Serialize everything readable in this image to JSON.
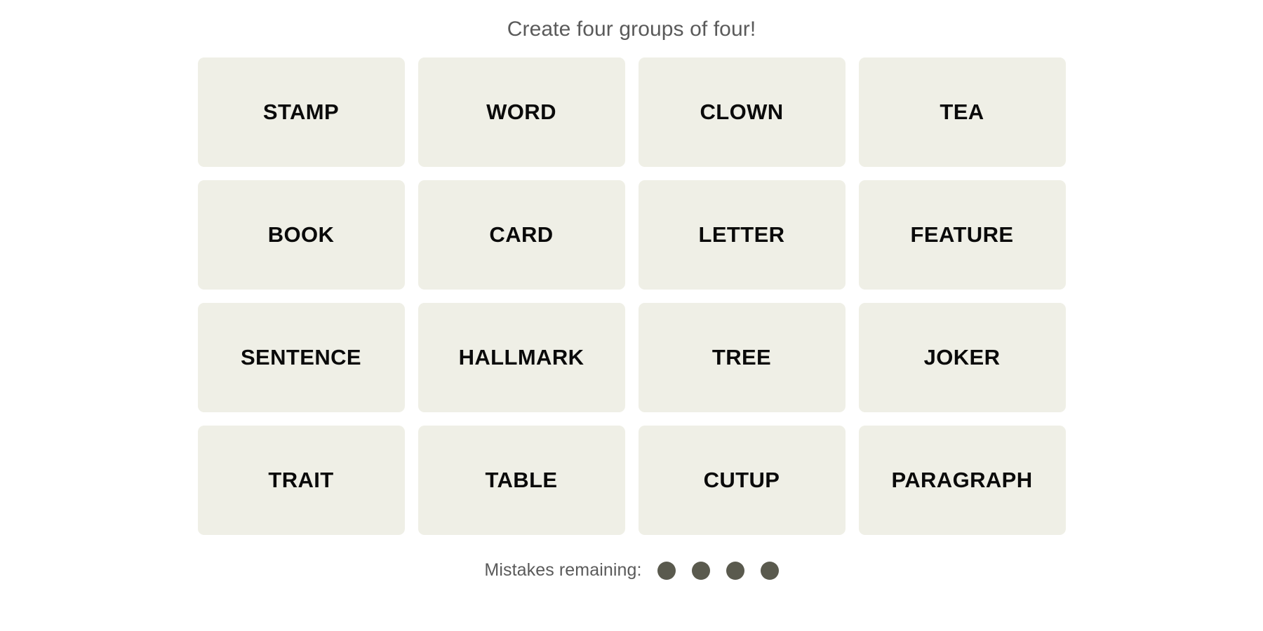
{
  "header": {
    "instruction": "Create four groups of four!"
  },
  "board": {
    "rows": 4,
    "columns": 4,
    "tiles": [
      {
        "label": "STAMP"
      },
      {
        "label": "WORD"
      },
      {
        "label": "CLOWN"
      },
      {
        "label": "TEA"
      },
      {
        "label": "BOOK"
      },
      {
        "label": "CARD"
      },
      {
        "label": "LETTER"
      },
      {
        "label": "FEATURE"
      },
      {
        "label": "SENTENCE"
      },
      {
        "label": "HALLMARK"
      },
      {
        "label": "TREE"
      },
      {
        "label": "JOKER"
      },
      {
        "label": "TRAIT"
      },
      {
        "label": "TABLE"
      },
      {
        "label": "CUTUP"
      },
      {
        "label": "PARAGRAPH"
      }
    ]
  },
  "footer": {
    "mistakes_label": "Mistakes remaining:",
    "mistakes_remaining": 4,
    "dots": [
      {
        "state": "filled"
      },
      {
        "state": "filled"
      },
      {
        "state": "filled"
      },
      {
        "state": "filled"
      }
    ]
  },
  "colors": {
    "page_background": "#ffffff",
    "tile_background": "#efefe6",
    "tile_text": "#0a0a0a",
    "instruction_text": "#5a5a5a",
    "mistakes_label_text": "#5a5a5a",
    "mistake_dot": "#5a5a4e"
  }
}
